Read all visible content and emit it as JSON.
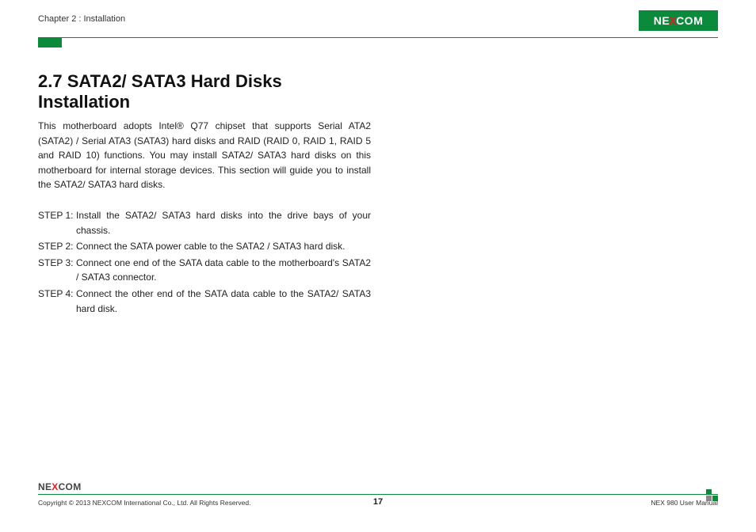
{
  "header": {
    "breadcrumb": "Chapter 2 : Installation",
    "logo_pre": "NE",
    "logo_x": "X",
    "logo_post": "COM"
  },
  "content": {
    "heading": "2.7 SATA2/ SATA3 Hard Disks Installation",
    "intro": "This motherboard adopts Intel® Q77 chipset that supports Serial ATA2 (SATA2) / Serial ATA3 (SATA3) hard disks and RAID (RAID 0, RAID 1, RAID 5 and RAID 10) functions. You may install SATA2/ SATA3 hard disks on this motherboard for internal storage devices. This section will guide you to install the SATA2/ SATA3 hard disks.",
    "steps": [
      {
        "label": "STEP 1:",
        "text": "Install the SATA2/ SATA3 hard disks into the drive bays of your chassis."
      },
      {
        "label": "STEP 2:",
        "text": "Connect the SATA power cable to the SATA2 / SATA3 hard disk."
      },
      {
        "label": "STEP 3:",
        "text": "Connect one end of the SATA data cable to the motherboard's SATA2 / SATA3 connector."
      },
      {
        "label": "STEP 4:",
        "text": "Connect the other end of the SATA data cable to the SATA2/ SATA3 hard disk."
      }
    ]
  },
  "footer": {
    "logo_pre": "NE",
    "logo_x": "X",
    "logo_post": "COM",
    "copyright": "Copyright © 2013 NEXCOM International Co., Ltd. All Rights Reserved.",
    "page": "17",
    "manual": "NEX 980 User Manual"
  }
}
